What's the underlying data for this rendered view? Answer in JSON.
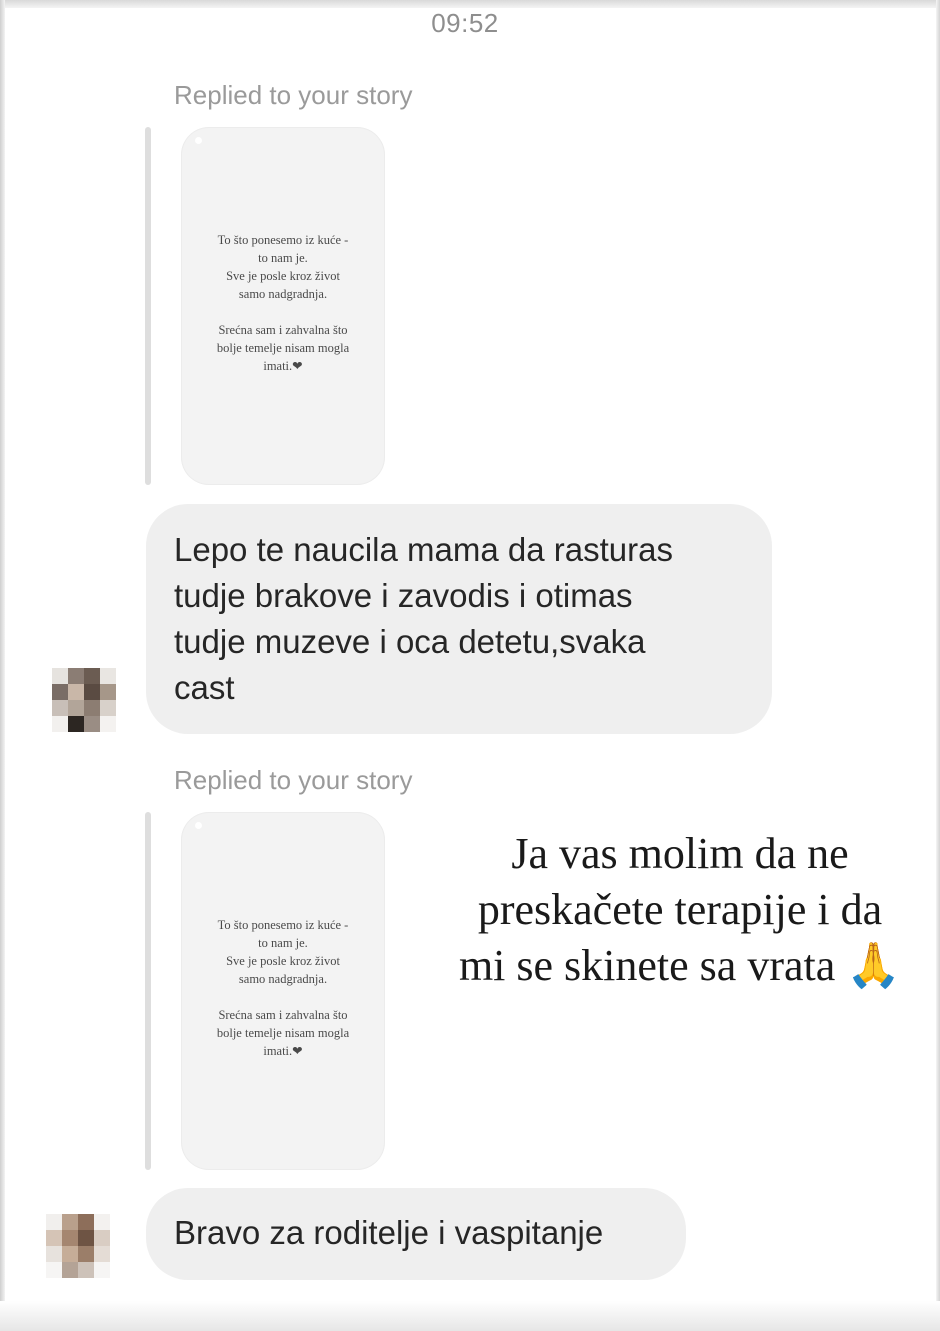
{
  "timestamp": "09:52",
  "messages": [
    {
      "replied_label": "Replied to your story",
      "story_text": "To što ponesemo iz kuće -\nto nam je.\nSve je posle kroz život\nsamo nadgradnja.\n\nSrećna sam i zahvalna što\nbolje temelje nisam mogla\nimati.❤",
      "text": "Lepo te naucila mama da rasturas\ntudje brakove i zavodis i otimas\ntudje muzeve i oca detetu,svaka\ncast"
    },
    {
      "replied_label": "Replied to your story",
      "story_text": "To što ponesemo iz kuće -\nto nam je.\nSve je posle kroz život\nsamo nadgradnja.\n\nSrećna sam i zahvalna što\nbolje temelje nisam mogla\nimati.❤",
      "text": "Bravo za roditelje i vaspitanje"
    }
  ],
  "overlay_caption": "Ja vas molim da ne\npreskačete terapije i da\nmi se skinete sa vrata 🙏",
  "colors": {
    "bubble": "#efefef",
    "muted_text": "#9a9a9a",
    "message_text": "#262626"
  }
}
